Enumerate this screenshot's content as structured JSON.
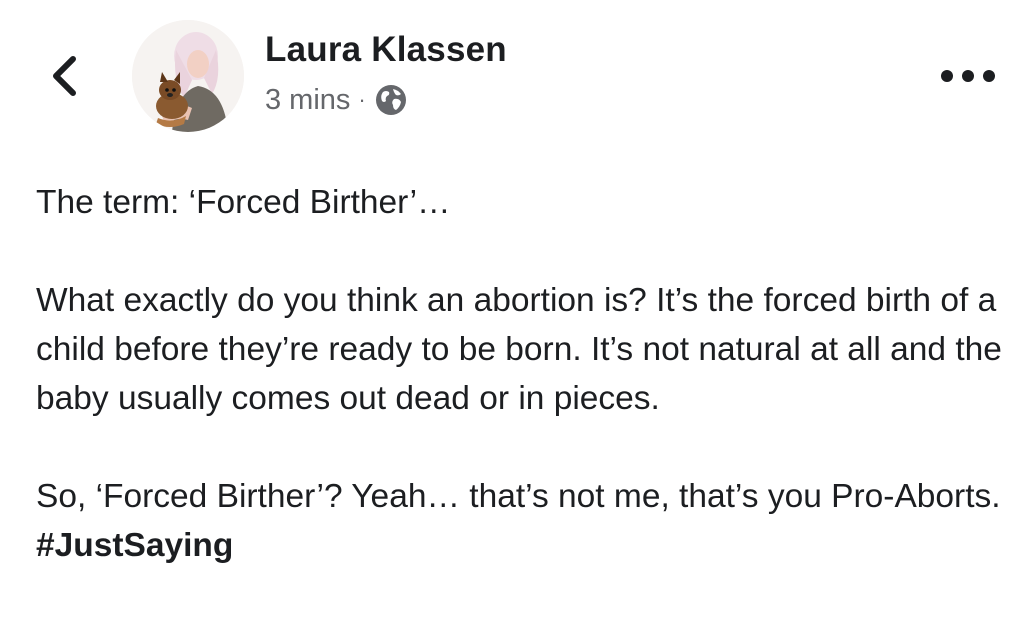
{
  "header": {
    "author_name": "Laura Klassen",
    "timestamp": "3 mins",
    "separator": "·",
    "audience_icon": "globe-icon",
    "back_icon": "chevron-left-icon",
    "more_icon": "more-dots-icon"
  },
  "post": {
    "paragraph_1": "The term: ‘Forced Birther’…",
    "paragraph_2": "What exactly do you think an abortion is? It’s the forced birth of a child before they’re ready to be born. It’s not natural at all and the baby usually comes out dead or in pieces.",
    "paragraph_3_text": "So, ‘Forced Birther’? Yeah… that’s not me, that’s you Pro-Aborts. ",
    "hashtag": "#JustSaying"
  },
  "colors": {
    "text": "#1c1e21",
    "secondary": "#65676b",
    "background": "#ffffff"
  }
}
